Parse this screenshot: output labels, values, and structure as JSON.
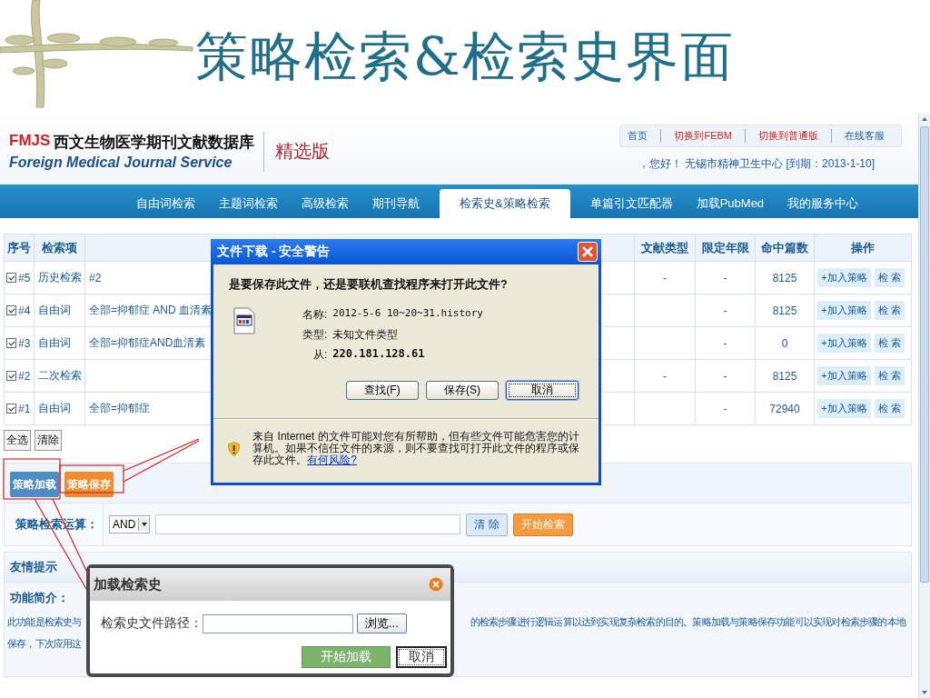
{
  "slide": {
    "title": "策略检索&检索史界面"
  },
  "header": {
    "logo_mark": "FMJS",
    "logo_name": "西文生物医学期刊文献数据库",
    "logo_subtitle": "Foreign Medical Journal Service",
    "edition": "精选版",
    "top_links": [
      {
        "label": "首页",
        "kind": "plain"
      },
      {
        "label": "切换到FEBM",
        "kind": "accent"
      },
      {
        "label": "切换到普通版",
        "kind": "accent"
      },
      {
        "label": "在线客服",
        "kind": "plain"
      }
    ],
    "greeting": "，您好！ 无锡市精神卫生中心 [到期：2013-1-10]"
  },
  "nav": [
    {
      "label": "自由词检索",
      "selected": false
    },
    {
      "label": "主题词检索",
      "selected": false
    },
    {
      "label": "高级检索",
      "selected": false
    },
    {
      "label": "期刊导航",
      "selected": false
    },
    {
      "label": "检索史&策略检索",
      "selected": true
    },
    {
      "label": "单篇引文匹配器",
      "selected": false
    },
    {
      "label": "加载PubMed",
      "selected": false
    },
    {
      "label": "我的服务中心",
      "selected": false
    }
  ],
  "history_table": {
    "columns": [
      "序号",
      "检索项",
      "文献类型",
      "限定年限",
      "命中篇数",
      "操作"
    ],
    "rows": [
      {
        "checked": true,
        "number": "#5",
        "field": "历史检索",
        "query": "#2",
        "doc_type": "-",
        "year_limit": "-",
        "hits": "8125",
        "actions": [
          "+加入策略",
          "检 索"
        ]
      },
      {
        "checked": true,
        "number": "#4",
        "field": "自由词",
        "query": "全部=抑郁症 AND 血清素",
        "year_limit": "-",
        "hits": "8125",
        "actions": [
          "+加入策略",
          "检 索"
        ]
      },
      {
        "checked": true,
        "number": "#3",
        "field": "自由词",
        "query": "全部=抑郁症AND血清素",
        "year_limit": "-",
        "hits": "0",
        "actions": [
          "+加入策略",
          "检 索"
        ]
      },
      {
        "checked": true,
        "number": "#2",
        "field": "二次检索",
        "doc_type": "-",
        "year_limit": "-",
        "hits": "8125",
        "actions": [
          "+加入策略",
          "检 索"
        ]
      },
      {
        "checked": true,
        "number": "#1",
        "field": "自由词",
        "query": "全部=抑郁症",
        "year_limit": "-",
        "hits": "72940",
        "actions": [
          "+加入策略",
          "检 索"
        ]
      }
    ],
    "buttons": [
      "全选",
      "清除"
    ]
  },
  "strategy": {
    "buttons": [
      {
        "label": "策略加载",
        "kind": "load"
      },
      {
        "label": "策略保存",
        "kind": "save"
      }
    ],
    "label": "策略检索运算：",
    "operator": "AND",
    "actions": [
      {
        "label": "清 除",
        "kind": "clear"
      },
      {
        "label": "开始检索",
        "kind": "search"
      }
    ]
  },
  "tips": {
    "title": "友情提示",
    "heading": "功能简介：",
    "lines": [
      {
        "left": "此功能是检索史与",
        "right": "的检索步骤进行逻辑运算以达到实现复杂检索的目的。策略加载与策略保存功能可以实现对检索步骤的本地"
      },
      {
        "left": "保存，下次应用这"
      }
    ]
  },
  "download_dialog": {
    "title": "文件下载 - 安全警告",
    "question": "是要保存此文件，还是要联机查找程序来打开此文件?",
    "fields": [
      {
        "label": "名称:",
        "value": "2012-5-6 10~20~31.history",
        "kind": "plain"
      },
      {
        "label": "类型:",
        "value": "未知文件类型",
        "kind": "plain"
      },
      {
        "label": "从:",
        "value": "220.181.128.61",
        "kind": "strong"
      }
    ],
    "buttons": [
      {
        "label": "查找(F)",
        "selected": false
      },
      {
        "label": "保存(S)",
        "selected": false
      },
      {
        "label": "取消",
        "selected": true
      }
    ],
    "warning": "来自 Internet 的文件可能对您有所帮助，但有些文件可能危害您的计算机。如果不信任文件的来源，则不要查找可打开此文件的程序或保存此文件。",
    "warning_link": "有何风险?"
  },
  "load_dialog": {
    "title": "加载检索史",
    "field_label": "检索史文件路径：",
    "browse": "浏览...",
    "buttons": [
      {
        "label": "开始加载",
        "kind": "primary"
      },
      {
        "label": "取消",
        "kind": "cancel"
      }
    ]
  }
}
